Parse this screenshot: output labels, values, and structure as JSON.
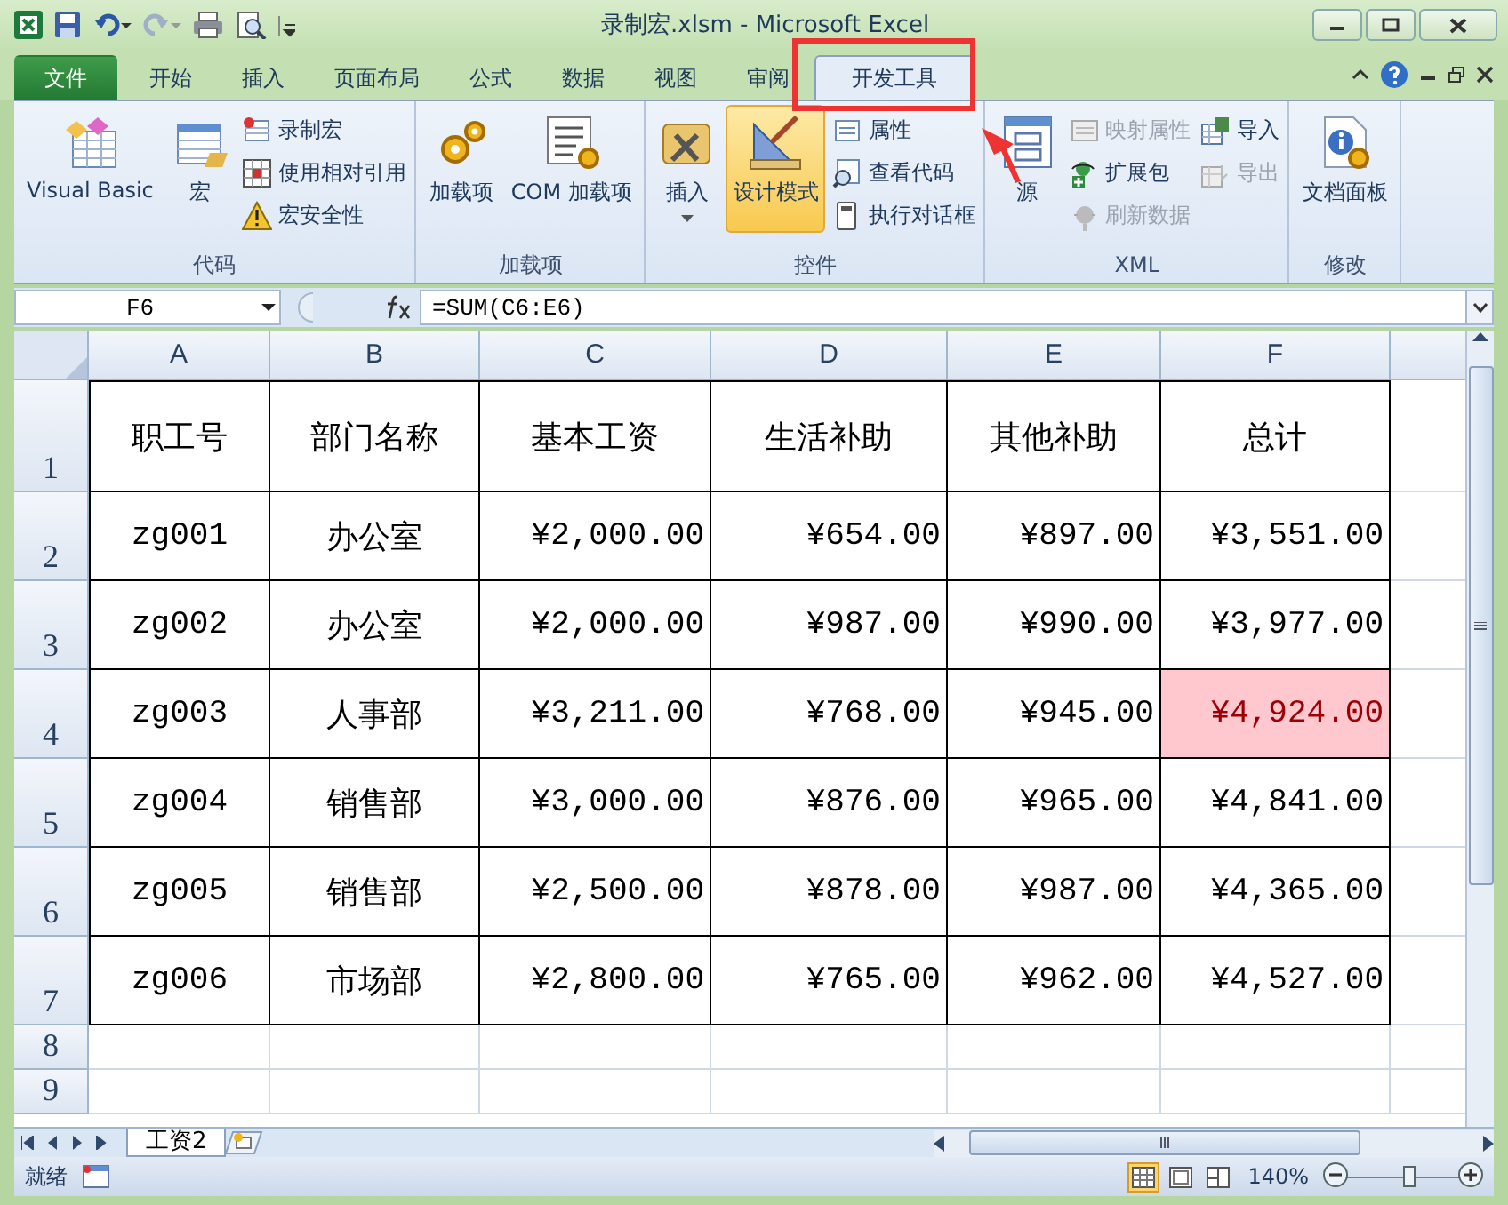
{
  "window": {
    "title": "录制宏.xlsm - Microsoft Excel"
  },
  "tabs": [
    {
      "label": "文件",
      "kind": "file",
      "selected": false
    },
    {
      "label": "开始",
      "kind": "tab",
      "selected": false
    },
    {
      "label": "插入",
      "kind": "tab",
      "selected": false
    },
    {
      "label": "页面布局",
      "kind": "tab",
      "selected": false
    },
    {
      "label": "公式",
      "kind": "tab",
      "selected": false
    },
    {
      "label": "数据",
      "kind": "tab",
      "selected": false
    },
    {
      "label": "视图",
      "kind": "tab",
      "selected": false
    },
    {
      "label": "审阅",
      "kind": "tab",
      "selected": false
    },
    {
      "label": "开发工具",
      "kind": "tab",
      "selected": true
    }
  ],
  "ribbon": {
    "groups": [
      {
        "label": "代码",
        "items": [
          {
            "label": "Visual Basic",
            "kind": "large",
            "disabled": false,
            "active": false
          },
          {
            "label": "宏",
            "kind": "large",
            "disabled": false,
            "active": false
          },
          {
            "label": "录制宏",
            "kind": "small",
            "disabled": false
          },
          {
            "label": "使用相对引用",
            "kind": "small",
            "disabled": false
          },
          {
            "label": "宏安全性",
            "kind": "small",
            "disabled": false
          }
        ]
      },
      {
        "label": "加载项",
        "items": [
          {
            "label": "加载项",
            "kind": "large",
            "disabled": false,
            "active": false
          },
          {
            "label": "COM 加载项",
            "kind": "large",
            "disabled": false,
            "active": false
          }
        ]
      },
      {
        "label": "控件",
        "items": [
          {
            "label": "插入",
            "kind": "large",
            "disabled": false,
            "active": false,
            "dropdown": true
          },
          {
            "label": "设计模式",
            "kind": "large",
            "disabled": false,
            "active": true
          },
          {
            "label": "属性",
            "kind": "small",
            "disabled": false
          },
          {
            "label": "查看代码",
            "kind": "small",
            "disabled": false
          },
          {
            "label": "执行对话框",
            "kind": "small",
            "disabled": false
          }
        ]
      },
      {
        "label": "XML",
        "items": [
          {
            "label": "源",
            "kind": "large",
            "disabled": false,
            "active": false
          },
          {
            "label": "映射属性",
            "kind": "small",
            "disabled": true
          },
          {
            "label": "扩展包",
            "kind": "small",
            "disabled": false
          },
          {
            "label": "刷新数据",
            "kind": "small",
            "disabled": true
          },
          {
            "label": "导入",
            "kind": "small",
            "disabled": false
          },
          {
            "label": "导出",
            "kind": "small",
            "disabled": true
          }
        ]
      },
      {
        "label": "修改",
        "items": [
          {
            "label": "文档面板",
            "kind": "large",
            "disabled": false,
            "active": false
          }
        ]
      }
    ]
  },
  "formula_bar": {
    "name_box": "F6",
    "formula": "=SUM(C6:E6)"
  },
  "sheet": {
    "columns": [
      "A",
      "B",
      "C",
      "D",
      "E",
      "F"
    ],
    "rows": [
      {
        "number": "1",
        "kind": "header",
        "cells": [
          {
            "text": "职工号",
            "highlighted": false
          },
          {
            "text": "部门名称",
            "highlighted": false
          },
          {
            "text": "基本工资",
            "highlighted": false
          },
          {
            "text": "生活补助",
            "highlighted": false
          },
          {
            "text": "其他补助",
            "highlighted": false
          },
          {
            "text": "总计",
            "highlighted": false
          }
        ]
      },
      {
        "number": "2",
        "kind": "data",
        "cells": [
          {
            "text": "zg001",
            "highlighted": false
          },
          {
            "text": "办公室",
            "highlighted": false
          },
          {
            "text": "¥2,000.00",
            "highlighted": false
          },
          {
            "text": "¥654.00",
            "highlighted": false
          },
          {
            "text": "¥897.00",
            "highlighted": false
          },
          {
            "text": "¥3,551.00",
            "highlighted": false
          }
        ]
      },
      {
        "number": "3",
        "kind": "data",
        "cells": [
          {
            "text": "zg002",
            "highlighted": false
          },
          {
            "text": "办公室",
            "highlighted": false
          },
          {
            "text": "¥2,000.00",
            "highlighted": false
          },
          {
            "text": "¥987.00",
            "highlighted": false
          },
          {
            "text": "¥990.00",
            "highlighted": false
          },
          {
            "text": "¥3,977.00",
            "highlighted": false
          }
        ]
      },
      {
        "number": "4",
        "kind": "data",
        "cells": [
          {
            "text": "zg003",
            "highlighted": false
          },
          {
            "text": "人事部",
            "highlighted": false
          },
          {
            "text": "¥3,211.00",
            "highlighted": false
          },
          {
            "text": "¥768.00",
            "highlighted": false
          },
          {
            "text": "¥945.00",
            "highlighted": false
          },
          {
            "text": "¥4,924.00",
            "highlighted": true
          }
        ]
      },
      {
        "number": "5",
        "kind": "data",
        "cells": [
          {
            "text": "zg004",
            "highlighted": false
          },
          {
            "text": "销售部",
            "highlighted": false
          },
          {
            "text": "¥3,000.00",
            "highlighted": false
          },
          {
            "text": "¥876.00",
            "highlighted": false
          },
          {
            "text": "¥965.00",
            "highlighted": false
          },
          {
            "text": "¥4,841.00",
            "highlighted": false
          }
        ]
      },
      {
        "number": "6",
        "kind": "data",
        "cells": [
          {
            "text": "zg005",
            "highlighted": false
          },
          {
            "text": "销售部",
            "highlighted": false
          },
          {
            "text": "¥2,500.00",
            "highlighted": false
          },
          {
            "text": "¥878.00",
            "highlighted": false
          },
          {
            "text": "¥987.00",
            "highlighted": false
          },
          {
            "text": "¥4,365.00",
            "highlighted": false
          }
        ]
      },
      {
        "number": "7",
        "kind": "data",
        "cells": [
          {
            "text": "zg006",
            "highlighted": false
          },
          {
            "text": "市场部",
            "highlighted": false
          },
          {
            "text": "¥2,800.00",
            "highlighted": false
          },
          {
            "text": "¥765.00",
            "highlighted": false
          },
          {
            "text": "¥962.00",
            "highlighted": false
          },
          {
            "text": "¥4,527.00",
            "highlighted": false
          }
        ]
      }
    ],
    "empty_rows": [
      "8",
      "9"
    ]
  },
  "sheet_tabs": [
    {
      "label": "工资2",
      "selected": true
    }
  ],
  "status_bar": {
    "status": "就绪",
    "views": [
      {
        "selected": true
      },
      {
        "selected": false
      },
      {
        "selected": false
      }
    ],
    "zoom": "140%",
    "zoom_slider": {
      "level": 0.55
    }
  }
}
